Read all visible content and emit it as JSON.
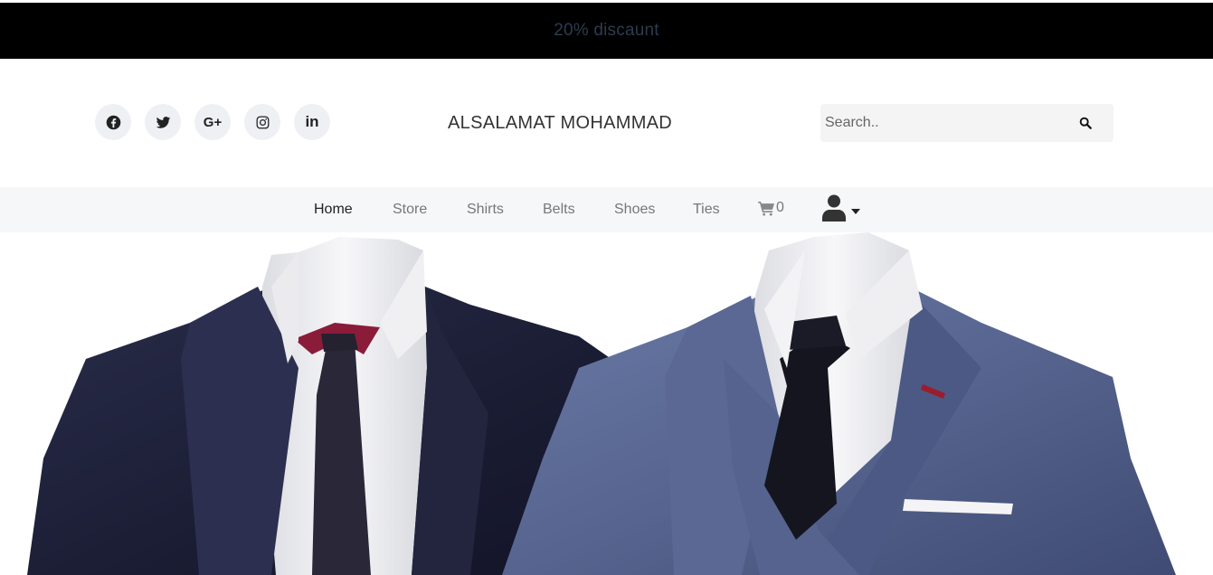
{
  "promo": {
    "text": "20% discaunt"
  },
  "header": {
    "brand": "ALSALAMAT MOHAMMAD",
    "social": [
      {
        "icon": "facebook-icon"
      },
      {
        "icon": "twitter-icon"
      },
      {
        "icon": "google-plus-icon",
        "glyph": "G+"
      },
      {
        "icon": "instagram-icon"
      },
      {
        "icon": "linkedin-icon",
        "glyph": "in"
      }
    ],
    "search": {
      "placeholder": "Search..",
      "value": "",
      "icon": "search-icon"
    }
  },
  "nav": {
    "items": [
      {
        "label": "Home",
        "active": true
      },
      {
        "label": "Store"
      },
      {
        "label": "Shirts"
      },
      {
        "label": "Belts"
      },
      {
        "label": "Shoes"
      },
      {
        "label": "Ties"
      }
    ],
    "cart": {
      "icon": "cart-icon",
      "count": "0"
    },
    "user": {
      "icon": "user-icon",
      "dropdown": "caret-down-icon"
    }
  },
  "hero": {
    "image": "two-suits-photo"
  },
  "colors": {
    "promo_bg": "#000000",
    "promo_text": "#2e3b4e",
    "nav_bg": "#f6f7f9",
    "social_bg": "#eef0f4"
  }
}
